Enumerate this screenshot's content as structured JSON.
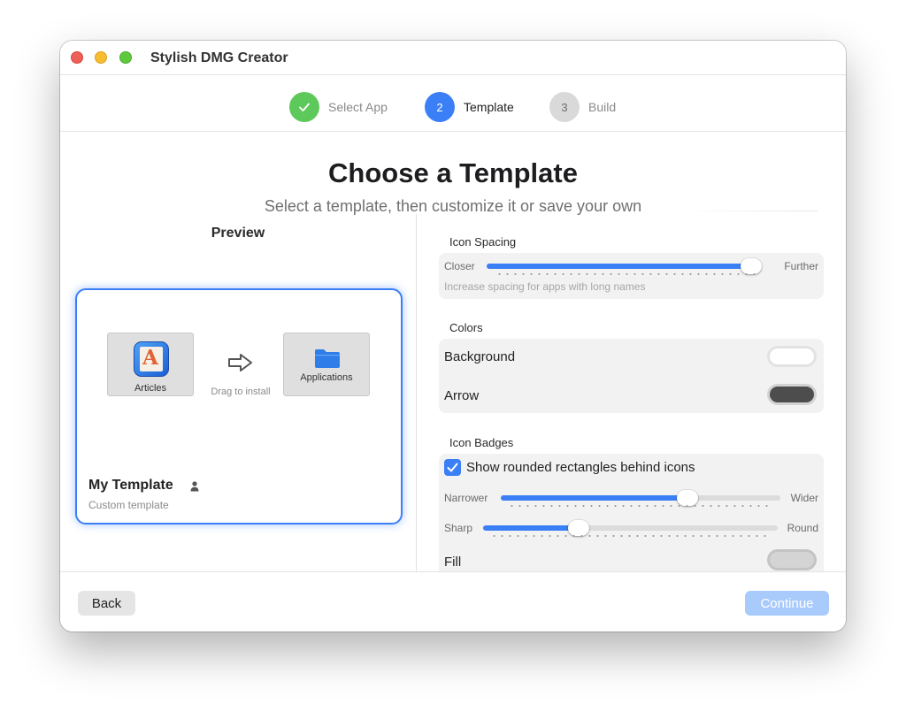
{
  "window": {
    "title": "Stylish DMG Creator"
  },
  "steps": [
    {
      "number": "",
      "label": "Select App",
      "state": "done",
      "color": "#5cc95a"
    },
    {
      "number": "2",
      "label": "Template",
      "state": "active",
      "color": "#3a7ff6"
    },
    {
      "number": "3",
      "label": "Build",
      "state": "pending",
      "color": "#d9d9d9"
    }
  ],
  "header": {
    "title": "Choose a Template",
    "subtitle": "Select a template, then customize it or save your own"
  },
  "preview": {
    "title": "Preview",
    "app_tile_label": "Articles",
    "drag_hint": "Drag to install",
    "apps_tile_label": "Applications",
    "template_name": "My Template",
    "template_subtitle": "Custom template"
  },
  "settings": {
    "icon_spacing": {
      "label": "Icon Spacing",
      "min_label": "Closer",
      "max_label": "Further",
      "value": 1.0,
      "hint": "Increase spacing for apps with long names"
    },
    "colors": {
      "label": "Colors",
      "background_label": "Background",
      "background_color": "#ffffff",
      "arrow_label": "Arrow",
      "arrow_color": "#4d4d4d"
    },
    "icon_badges": {
      "label": "Icon Badges",
      "checkbox_label": "Show rounded rectangles behind icons",
      "checked": true,
      "width_min_label": "Narrower",
      "width_max_label": "Wider",
      "width_value": 0.68,
      "corner_min_label": "Sharp",
      "corner_max_label": "Round",
      "corner_value": 0.31,
      "fill_label": "Fill",
      "fill_color": "#d4d4d4"
    }
  },
  "footer": {
    "back_label": "Back",
    "continue_label": "Continue"
  }
}
